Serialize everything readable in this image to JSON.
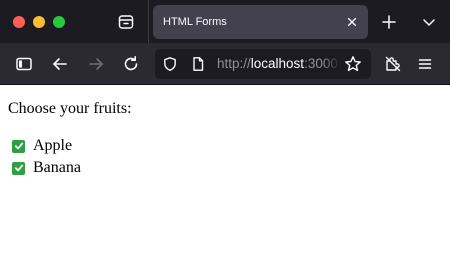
{
  "window": {
    "tab": {
      "title": "HTML Forms",
      "active": true
    },
    "url": {
      "prefix": "http://",
      "host": "localhost",
      "rest": ":3000"
    }
  },
  "page": {
    "prompt": "Choose your fruits:",
    "fruits": [
      {
        "label": "Apple",
        "checked": true
      },
      {
        "label": "Banana",
        "checked": true
      }
    ]
  },
  "icons": {
    "tabs_menu": "tabs-menu-icon",
    "tab_close": "close-icon",
    "new_tab": "plus-icon",
    "list_all_tabs": "chevron-down-icon",
    "sidebar": "sidebar-icon",
    "back": "arrow-left-icon",
    "forward": "arrow-right-icon",
    "reload": "reload-icon",
    "tracking": "shield-icon",
    "page_info": "page-icon",
    "bookmark": "star-icon",
    "extensions": "puzzle-icon",
    "menu": "hamburger-menu-icon"
  },
  "colors": {
    "tabbar_bg": "#1c1b22",
    "toolbar_bg": "#2b2a33",
    "active_tab_bg": "#42414d",
    "checkbox_checked": "#2ea043",
    "close_red": "#ff5f57",
    "minimize_yellow": "#febc2e",
    "zoom_green": "#28c840"
  }
}
